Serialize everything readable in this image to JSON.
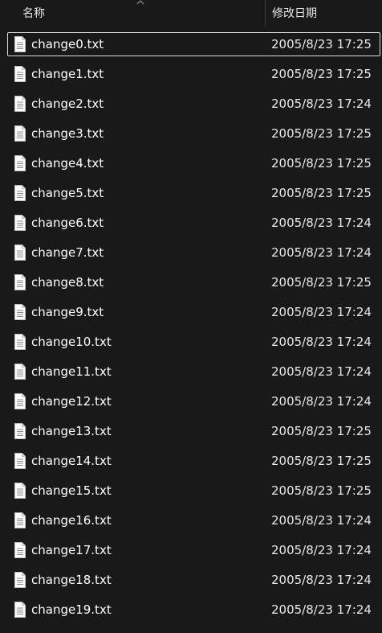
{
  "header": {
    "name_label": "名称",
    "date_label": "修改日期",
    "sort_icon": "chevron-up-icon"
  },
  "files": [
    {
      "name": "change0.txt",
      "date": "2005/8/23 17:25",
      "selected": true
    },
    {
      "name": "change1.txt",
      "date": "2005/8/23 17:25"
    },
    {
      "name": "change2.txt",
      "date": "2005/8/23 17:24"
    },
    {
      "name": "change3.txt",
      "date": "2005/8/23 17:25"
    },
    {
      "name": "change4.txt",
      "date": "2005/8/23 17:25"
    },
    {
      "name": "change5.txt",
      "date": "2005/8/23 17:25"
    },
    {
      "name": "change6.txt",
      "date": "2005/8/23 17:24"
    },
    {
      "name": "change7.txt",
      "date": "2005/8/23 17:24"
    },
    {
      "name": "change8.txt",
      "date": "2005/8/23 17:25"
    },
    {
      "name": "change9.txt",
      "date": "2005/8/23 17:24"
    },
    {
      "name": "change10.txt",
      "date": "2005/8/23 17:24"
    },
    {
      "name": "change11.txt",
      "date": "2005/8/23 17:24"
    },
    {
      "name": "change12.txt",
      "date": "2005/8/23 17:24"
    },
    {
      "name": "change13.txt",
      "date": "2005/8/23 17:25"
    },
    {
      "name": "change14.txt",
      "date": "2005/8/23 17:25"
    },
    {
      "name": "change15.txt",
      "date": "2005/8/23 17:25"
    },
    {
      "name": "change16.txt",
      "date": "2005/8/23 17:24"
    },
    {
      "name": "change17.txt",
      "date": "2005/8/23 17:24"
    },
    {
      "name": "change18.txt",
      "date": "2005/8/23 17:24"
    },
    {
      "name": "change19.txt",
      "date": "2005/8/23 17:24"
    }
  ],
  "colors": {
    "background": "#191919",
    "text": "#ffffff",
    "selection_border": "#d9d9d9"
  }
}
